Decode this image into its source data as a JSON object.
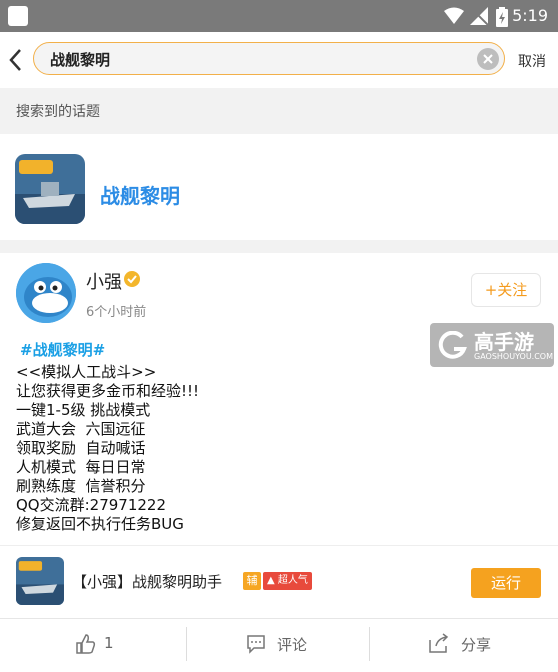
{
  "status_bar": {
    "time": "5:19"
  },
  "search": {
    "query": "战舰黎明",
    "cancel_label": "取消"
  },
  "section_title": "搜索到的话题",
  "topic": {
    "name": "战舰黎明"
  },
  "post": {
    "username": "小强",
    "time_ago": "6个小时前",
    "follow_label": "+关注",
    "hashtag": "#战舰黎明#",
    "lines": [
      "<<模拟人工战斗>>",
      "让您获得更多金币和经验!!!",
      "一键1-5级 挑战模式",
      "武道大会  六国远征",
      "领取奖励  自动喊话",
      "人机模式  每日日常",
      "刷熟练度  信誉积分",
      "QQ交流群:27971222",
      "修复返回不执行任务BUG"
    ]
  },
  "watermark": {
    "title": "高手游",
    "subtitle": "GAOSHOUYOU.COM"
  },
  "app": {
    "name": "【小强】战舰黎明助手",
    "badge_aux": "辅",
    "badge_hot": "超人气",
    "run_label": "运行"
  },
  "actions": {
    "like_count": "1",
    "comment_label": "评论",
    "share_label": "分享"
  },
  "colors": {
    "accent": "#f5a21f",
    "link": "#2c8ce5",
    "hashtag": "#1ba0e5"
  }
}
